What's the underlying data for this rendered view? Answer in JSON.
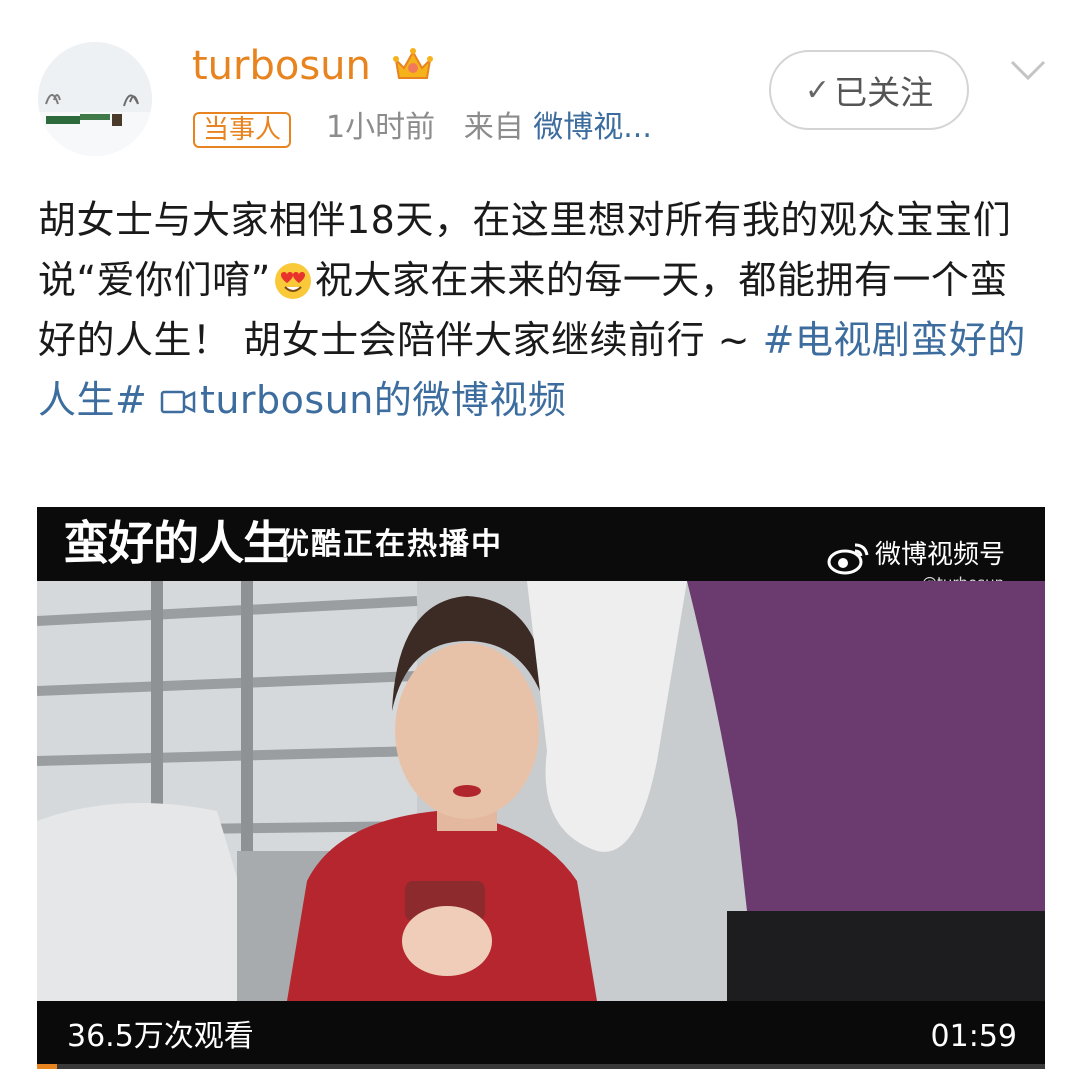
{
  "user": {
    "name": "turbosun",
    "tag": "当事人",
    "time": "1小时前",
    "from_label": "来自",
    "source": "微博视..."
  },
  "follow_button": {
    "label": "已关注",
    "icon": "check-icon"
  },
  "post": {
    "text": "胡女士与大家相伴18天，在这里想对所有我的观众宝宝们说“爱你们唷”",
    "emoji": "heart-eyes-emoji",
    "text2": "祝大家在未来的每一天，都能拥有一个蛮好的人生！ 胡女士会陪伴大家继续前行 ~ ",
    "hashtag": "#电视剧蛮好的人生#",
    "video_link": "turbosun的微博视频"
  },
  "video": {
    "show_title": "蛮好的人生",
    "now_playing": "优酷正在热播中",
    "brand": "微博视频号",
    "handle": "@turbosun",
    "views": "36.5万次观看",
    "duration": "01:59",
    "progress": 0.02
  },
  "colors": {
    "accent": "#e8841f",
    "link": "#3d6d9e",
    "meta": "#8c8c8c"
  }
}
